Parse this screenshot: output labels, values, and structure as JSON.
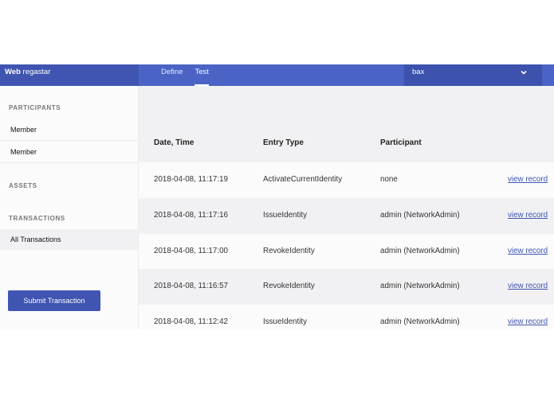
{
  "header": {
    "brand_bold": "Web",
    "brand_rest": "regastar",
    "tabs": [
      {
        "label": "Define"
      },
      {
        "label": "Test"
      }
    ],
    "network_select": {
      "value": "bax",
      "icon": "chevron-down-icon"
    }
  },
  "sidebar": {
    "participants_title": "PARTICIPANTS",
    "participants": [
      {
        "label": "Member"
      },
      {
        "label": "Member"
      }
    ],
    "assets_title": "ASSETS",
    "transactions_title": "TRANSACTIONS",
    "transactions": [
      {
        "label": "All Transactions"
      }
    ],
    "submit_label": "Submit Transaction"
  },
  "table": {
    "columns": [
      "Date, Time",
      "Entry Type",
      "Participant"
    ],
    "rows": [
      {
        "datetime": "2018-04-08, 11:17:19",
        "type": "ActivateCurrentIdentity",
        "participant": "none",
        "action": "view record"
      },
      {
        "datetime": "2018-04-08, 11:17:16",
        "type": "IssueIdentity",
        "participant": "admin (NetworkAdmin)",
        "action": "view record"
      },
      {
        "datetime": "2018-04-08, 11:17:00",
        "type": "RevokeIdentity",
        "participant": "admin (NetworkAdmin)",
        "action": "view record"
      },
      {
        "datetime": "2018-04-08, 11:16:57",
        "type": "RevokeIdentity",
        "participant": "admin (NetworkAdmin)",
        "action": "view record"
      },
      {
        "datetime": "2018-04-08, 11:12:42",
        "type": "IssueIdentity",
        "participant": "admin (NetworkAdmin)",
        "action": "view record"
      }
    ]
  },
  "colors": {
    "topbar": "#4a63c4",
    "brand_bg": "#3f55b1",
    "accent": "#3f55b1"
  }
}
